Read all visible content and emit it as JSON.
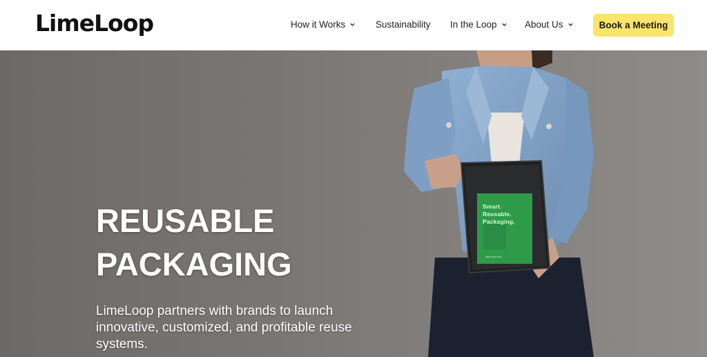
{
  "header": {
    "logo_text": "LimeLoop",
    "nav": [
      {
        "label": "How it Works",
        "has_dropdown": true
      },
      {
        "label": "Sustainability",
        "has_dropdown": false
      },
      {
        "label": "In the Loop",
        "has_dropdown": true
      },
      {
        "label": "About Us",
        "has_dropdown": true
      }
    ],
    "cta_label": "Book a Meeting"
  },
  "hero": {
    "title_line1": "REUSABLE",
    "title_line2": "PACKAGING",
    "subtitle": "LimeLoop partners with brands to launch innovative, customized, and profitable reuse systems.",
    "package_text_1": "Smart.",
    "package_text_2": "Reusable.",
    "package_text_3": "Packaging.",
    "package_url": "limeloop.com"
  },
  "colors": {
    "cta_background": "#fbe46a",
    "hero_background": "#7a7775",
    "package_green": "#2e9a4a",
    "jacket_denim": "#7f9fc2",
    "text_white": "#ffffff"
  },
  "icons": [
    "chevron-down-icon"
  ]
}
